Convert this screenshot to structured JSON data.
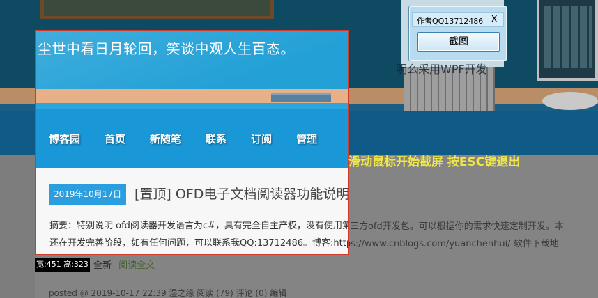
{
  "site": {
    "title": "尘世中看日月轮回，笑谈中观人生百态。",
    "nav": [
      "博客园",
      "首页",
      "新随笔",
      "联系",
      "订阅",
      "管理"
    ]
  },
  "post": {
    "date": "2019年10月17日",
    "title": "[置顶] OFD电子文档阅读器功能说明（采用WPF开发，永久免费）",
    "excerpt_line1": "摘要：特别说明 ofd阅读器开发语言为c#，具有完全自主产权，没有使用第三方ofd开发包。可以根据你的需求快速定制开发。本",
    "excerpt_line2": "还在开发完善阶段，如有任何问题，可以联系我QQ:13712486。博客:https://www.cnblogs.com/yuanchenhui/ 软件下载地",
    "newest_label": "全新",
    "read_more": "阅读全文",
    "meta": "posted @ 2019-10-17 22:39 湿之缘 阅读 (79) 评论 (0) 编辑"
  },
  "background": {
    "ghost_title": "明么采用WPF开发"
  },
  "capture_tool": {
    "size_readout": "宽:451 高:323",
    "hint": "滑动鼠标开始截屏 按ESC键退出",
    "dialog_title": "作者QQ13712486",
    "close_label": "X",
    "capture_button": "截图"
  },
  "colors": {
    "selection_border": "#d23b2b",
    "hint_text": "#f0e64a",
    "nav_bar": "#1a97d6",
    "date_badge": "#2b9ee0"
  }
}
